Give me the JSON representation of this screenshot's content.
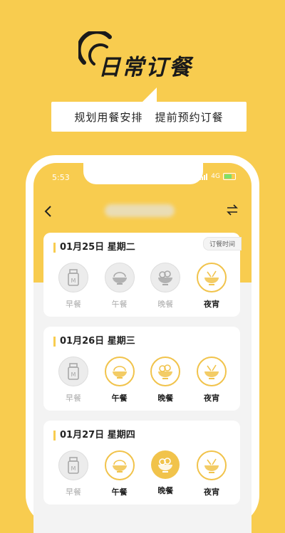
{
  "promo": {
    "title": "日常订餐",
    "tagline_a": "规划用餐安排",
    "tagline_b": "提前预约订餐"
  },
  "status_bar": {
    "time": "5:53",
    "network": "4G"
  },
  "nav": {
    "back_icon": "chevron-left-icon",
    "switch_icon": "swap-icon"
  },
  "order_time_label": "订餐时间",
  "days": [
    {
      "date": "01月25日 星期二",
      "meals": [
        {
          "label": "早餐",
          "state": "off",
          "icon": "milk-carton-icon"
        },
        {
          "label": "午餐",
          "state": "off",
          "icon": "rice-bowl-icon"
        },
        {
          "label": "晚餐",
          "state": "off",
          "icon": "salad-bowl-icon"
        },
        {
          "label": "夜宵",
          "state": "on",
          "icon": "noodle-bowl-icon"
        }
      ]
    },
    {
      "date": "01月26日 星期三",
      "meals": [
        {
          "label": "早餐",
          "state": "off",
          "icon": "milk-carton-icon"
        },
        {
          "label": "午餐",
          "state": "on",
          "icon": "rice-bowl-icon"
        },
        {
          "label": "晚餐",
          "state": "on",
          "icon": "salad-bowl-icon"
        },
        {
          "label": "夜宵",
          "state": "on",
          "icon": "noodle-bowl-icon"
        }
      ]
    },
    {
      "date": "01月27日 星期四",
      "meals": [
        {
          "label": "早餐",
          "state": "off",
          "icon": "milk-carton-icon"
        },
        {
          "label": "午餐",
          "state": "on",
          "icon": "rice-bowl-icon"
        },
        {
          "label": "晚餐",
          "state": "selected",
          "icon": "salad-bowl-icon"
        },
        {
          "label": "夜宵",
          "state": "on",
          "icon": "noodle-bowl-icon"
        }
      ]
    }
  ],
  "colors": {
    "accent": "#F8CC4F",
    "ring": "#F1C34B",
    "inactive": "#ECECEC"
  }
}
